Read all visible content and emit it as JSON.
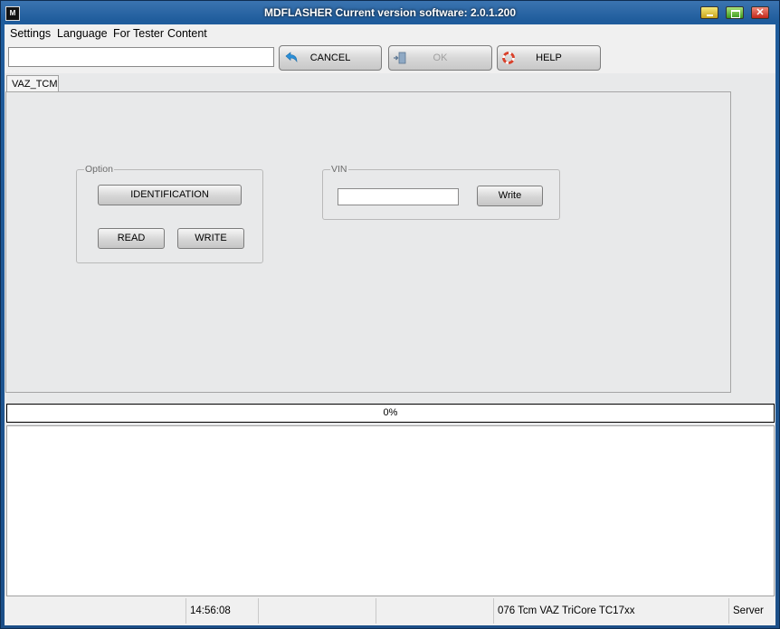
{
  "window": {
    "app_icon_text": "M",
    "title": "MDFLASHER  Current version software: 2.0.1.200"
  },
  "menu": {
    "items": [
      "Settings",
      "Language",
      "For Tester",
      "Content"
    ]
  },
  "toolbar": {
    "input_value": "",
    "cancel_label": "CANCEL",
    "ok_label": "OK",
    "help_label": "HELP"
  },
  "tabs": [
    {
      "label": "VAZ_TCM",
      "selected": true
    }
  ],
  "option_group": {
    "title": "Option",
    "identification_label": "IDENTIFICATION",
    "read_label": "READ",
    "write_label": "WRITE"
  },
  "vin_group": {
    "title": "VIN",
    "input_value": "",
    "write_label": "Write"
  },
  "progress": {
    "text": "0%",
    "value": 0
  },
  "status": {
    "cells": [
      "",
      "14:56:08",
      "",
      "",
      "076 Tcm VAZ TriCore TC17xx",
      "Server"
    ]
  },
  "colors": {
    "titlebar": "#1f5c9c",
    "client_bg": "#e8e9ea",
    "cancel_arrow": "#2a8fd8",
    "help_ring": "#d9412b"
  },
  "icons": {
    "cancel": "back-arrow-icon",
    "ok": "exit-door-icon",
    "help": "lifebuoy-icon"
  }
}
